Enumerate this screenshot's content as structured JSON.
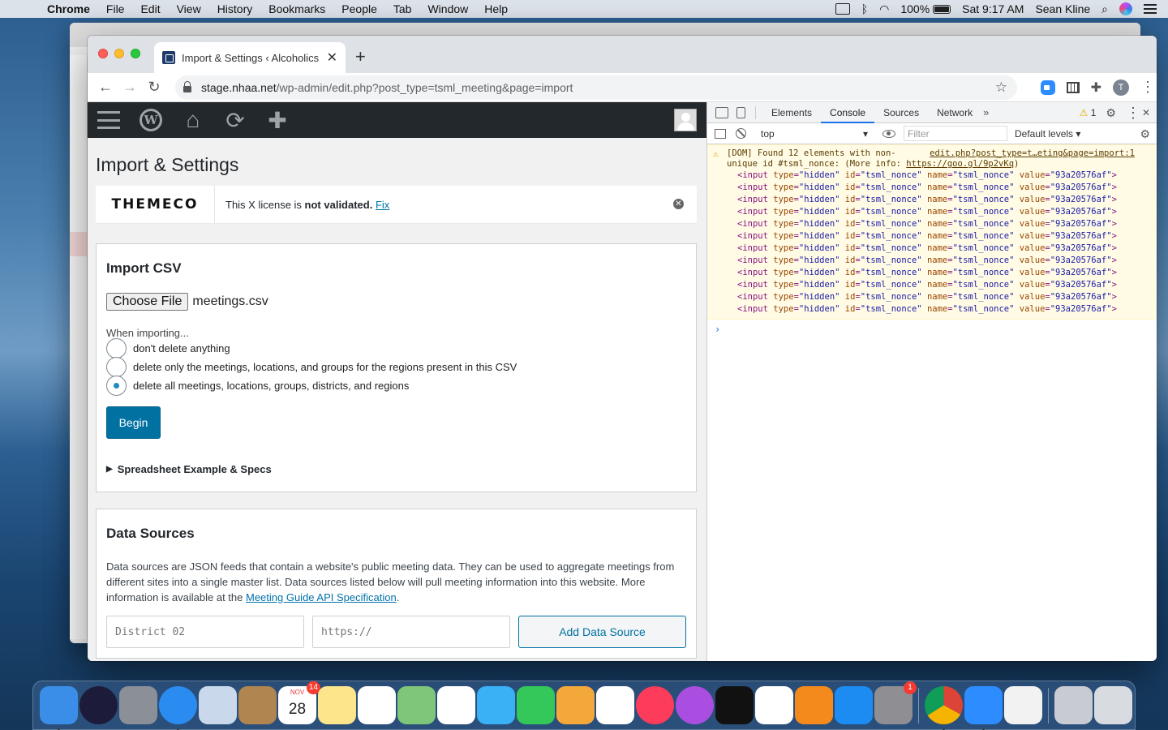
{
  "menubar": {
    "app": "Chrome",
    "items": [
      "File",
      "Edit",
      "View",
      "History",
      "Bookmarks",
      "People",
      "Tab",
      "Window",
      "Help"
    ],
    "battery": "100%",
    "clock": "Sat 9:17 AM",
    "user": "Sean Kline"
  },
  "browser": {
    "tab_title": "Import & Settings ‹ Alcoholics",
    "url_host": "stage.nhaa.net",
    "url_path": "/wp-admin/edit.php?post_type=tsml_meeting&page=import",
    "avatar_letter": "T"
  },
  "wp": {
    "page_title": "Import & Settings",
    "notice": {
      "brand": "THEMECO",
      "msg_prefix": "This X license is ",
      "msg_bold": "not validated.",
      "msg_link": "Fix"
    },
    "import_csv": {
      "heading": "Import CSV",
      "choose_file_label": "Choose File",
      "file_name": "meetings.csv",
      "when_label": "When importing...",
      "options": [
        {
          "label": "don't delete anything",
          "checked": false
        },
        {
          "label": "delete only the meetings, locations, and groups for the regions present in this CSV",
          "checked": false
        },
        {
          "label": "delete all meetings, locations, groups, districts, and regions",
          "checked": true
        }
      ],
      "begin_label": "Begin",
      "details_label": "Spreadsheet Example & Specs"
    },
    "data_sources": {
      "heading": "Data Sources",
      "desc": "Data sources are JSON feeds that contain a website's public meeting data. They can be used to aggregate meetings from different sites into a single master list. Data sources listed below will pull meeting information into this website. More information is available at the ",
      "link": "Meeting Guide API Specification",
      "desc_end": ".",
      "name_placeholder": "District 02",
      "url_placeholder": "https://",
      "add_label": "Add Data Source"
    }
  },
  "devtools": {
    "tabs": [
      "Elements",
      "Console",
      "Sources",
      "Network"
    ],
    "active_tab": "Console",
    "more": "»",
    "warning_count": "1",
    "context": "top",
    "filter_placeholder": "Filter",
    "levels": "Default levels ▾",
    "warning": {
      "line1": "[DOM] Found 12 elements with non-",
      "line2_prefix": "unique id #tsml_nonce: (More info: ",
      "link": "https://goo.gl/9p2vKq",
      "line2_suffix": ")",
      "source": "edit.php?post_type=t…eting&page=import:1"
    },
    "code_line": {
      "tag": "<input",
      "type_attr": "type",
      "type_val": "\"hidden\"",
      "id_attr": "id",
      "id_val": "\"tsml_nonce\"",
      "name_attr": "name",
      "name_val": "\"tsml_nonce\"",
      "value_attr": "value",
      "value_val": "\"93a20576af\"",
      "close": ">"
    },
    "code_line_count": 12,
    "prompt": "›"
  },
  "dock": {
    "calendar_month": "NOV",
    "calendar_day": "28",
    "calendar_badge": "14",
    "settings_badge": "1",
    "icons": [
      "finder",
      "siri",
      "launchpad",
      "safari",
      "mail",
      "contacts",
      "calendar",
      "notes",
      "reminders",
      "maps",
      "photos",
      "messages",
      "facetime",
      "pages",
      "numbers",
      "music",
      "podcasts",
      "tv",
      "news",
      "books",
      "app-store",
      "system-preferences",
      "chrome",
      "zoom",
      "textedit",
      "downloads",
      "trash"
    ],
    "colors": {
      "finder": "#3b8ee8",
      "siri": "#1c1c3a",
      "launchpad": "#8a8f98",
      "safari": "#2a8cf0",
      "mail": "#c9d8ea",
      "contacts": "#b08550",
      "calendar": "#ffffff",
      "notes": "#fce58a",
      "reminders": "#ffffff",
      "maps": "#7fc67a",
      "photos": "#ffffff",
      "messages": "#3ab0f5",
      "facetime": "#34c759",
      "pages": "#f4a83a",
      "numbers": "#ffffff",
      "music": "#fc3c5a",
      "podcasts": "#a94ee0",
      "tv": "#111111",
      "news": "#ffffff",
      "books": "#f48a1c",
      "app-store": "#1c8cf2",
      "system-preferences": "#8e8e93",
      "chrome": "#ffffff",
      "zoom": "#2d8cff",
      "textedit": "#f2f2f2",
      "downloads": "#c8ccd2",
      "trash": "#d8dce0"
    }
  }
}
